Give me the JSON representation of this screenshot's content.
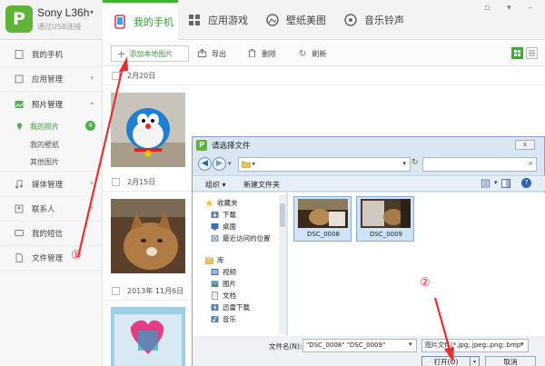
{
  "header": {
    "logo_letter": "P",
    "device_name": "Sony L36h",
    "device_sub": "通过USB连接",
    "tabs": [
      {
        "label": "我的手机",
        "icon": "phone-icon",
        "active": true
      },
      {
        "label": "应用游戏",
        "icon": "apps-icon",
        "active": false
      },
      {
        "label": "壁纸美图",
        "icon": "wallpaper-icon",
        "active": false
      },
      {
        "label": "音乐铃声",
        "icon": "music-icon",
        "active": false
      }
    ],
    "accent_color": "#44b135"
  },
  "sidebar": {
    "items": [
      {
        "label": "我的手机",
        "icon": "phone-outline-icon"
      },
      {
        "label": "应用管理",
        "icon": "apps-outline-icon"
      },
      {
        "label": "照片管理",
        "icon": "photo-icon"
      },
      {
        "label": "媒体管理",
        "icon": "music-note-icon"
      },
      {
        "label": "联系人",
        "icon": "contacts-icon"
      },
      {
        "label": "我的短信",
        "icon": "message-icon"
      },
      {
        "label": "文件管理",
        "icon": "file-icon"
      }
    ],
    "photo_subitems": [
      {
        "label": "我的照片",
        "badge": "4",
        "active": true
      },
      {
        "label": "我的壁纸",
        "active": false
      },
      {
        "label": "其他图片",
        "active": false
      }
    ]
  },
  "toolbar": {
    "add_label": "添加本地图片",
    "export_label": "导出",
    "delete_label": "删除",
    "refresh_label": "刷新"
  },
  "photo_groups": [
    {
      "date": "2月20日"
    },
    {
      "date": "2月15日"
    },
    {
      "date": "2013年 11月6日"
    }
  ],
  "dialog": {
    "title": "请选择文件",
    "close_label": "x",
    "organize_label": "组织",
    "new_folder_label": "新建文件夹",
    "tree": [
      {
        "label": "收藏夹",
        "icon": "star-icon"
      },
      {
        "label": "下载",
        "icon": "download-icon"
      },
      {
        "label": "桌面",
        "icon": "desktop-icon"
      },
      {
        "label": "最近访问的位置",
        "icon": "recent-icon"
      },
      {
        "label": "库",
        "icon": "library-icon"
      },
      {
        "label": "视频",
        "icon": "video-icon"
      },
      {
        "label": "图片",
        "icon": "picture-icon"
      },
      {
        "label": "文档",
        "icon": "document-icon"
      },
      {
        "label": "迅雷下载",
        "icon": "thunder-icon"
      },
      {
        "label": "音乐",
        "icon": "music-icon"
      }
    ],
    "files": [
      {
        "name": "DSC_0008",
        "selected": true
      },
      {
        "name": "DSC_0009",
        "selected": true
      }
    ],
    "filename_label": "文件名(N):",
    "filename_value": "\"DSC_0008\" \"DSC_0009\"",
    "filetype_value": "图片文件(*.jpg;.jpeg;.png;.bmp",
    "open_label": "打开(O)",
    "cancel_label": "取消"
  },
  "annotations": {
    "step1": "①",
    "step2": "②",
    "color": "#e53030"
  }
}
